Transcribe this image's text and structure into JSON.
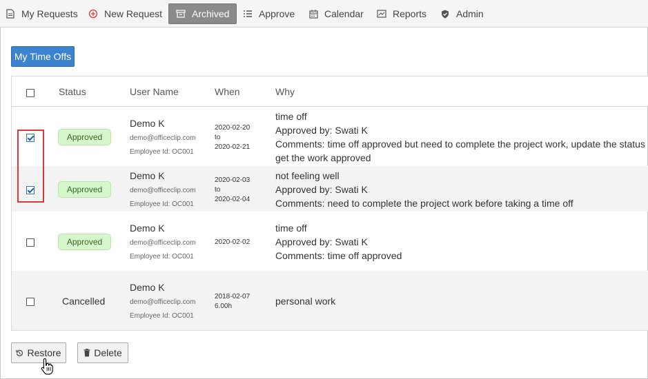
{
  "nav": {
    "items": [
      {
        "label": "My Requests",
        "icon": "document-icon"
      },
      {
        "label": "New Request",
        "icon": "plus-circle-icon"
      },
      {
        "label": "Archived",
        "icon": "archive-icon",
        "active": true
      },
      {
        "label": "Approve",
        "icon": "list-icon"
      },
      {
        "label": "Calendar",
        "icon": "calendar-icon"
      },
      {
        "label": "Reports",
        "icon": "chart-icon"
      },
      {
        "label": "Admin",
        "icon": "shield-icon"
      }
    ]
  },
  "my_time_offs_label": "My Time Offs",
  "table": {
    "headers": {
      "status": "Status",
      "user_name": "User Name",
      "when": "When",
      "why": "Why"
    },
    "rows": [
      {
        "checked": true,
        "status": "Approved",
        "name": "Demo K",
        "email": "demo@officeclip.com",
        "employee": "Employee Id: OC001",
        "when1": "2020-02-20",
        "when2": "to",
        "when3": "2020-02-21",
        "why1": "time off",
        "why2": "Approved by: Swati K",
        "why3": "Comments: time off approved but need to complete the project work, update the status and",
        "why4": "get the work approved"
      },
      {
        "checked": true,
        "status": "Approved",
        "name": "Demo K",
        "email": "demo@officeclip.com",
        "employee": "Employee Id: OC001",
        "when1": "2020-02-03",
        "when2": "to",
        "when3": "2020-02-04",
        "why1": "not feeling well",
        "why2": "Approved by: Swati K",
        "why3": "Comments: need to complete the project work before taking a time off"
      },
      {
        "checked": false,
        "status": "Approved",
        "name": "Demo K",
        "email": "demo@officeclip.com",
        "employee": "Employee Id: OC001",
        "when1": "2020-02-02",
        "why1": "time off",
        "why2": "Approved by: Swati K",
        "why3": "Comments: time off approved"
      },
      {
        "checked": false,
        "status": "Cancelled",
        "name": "Demo K",
        "email": "demo@officeclip.com",
        "employee": "Employee Id: OC001",
        "when1": "2018-02-07",
        "when2": "6.00h",
        "why1": "personal work"
      }
    ]
  },
  "buttons": {
    "restore": "Restore",
    "delete": "Delete"
  },
  "colors": {
    "primary": "#3b83cf",
    "approved_bg": "#d6f6cc",
    "highlight": "#d9383a",
    "active_nav": "#8a8a8a"
  }
}
